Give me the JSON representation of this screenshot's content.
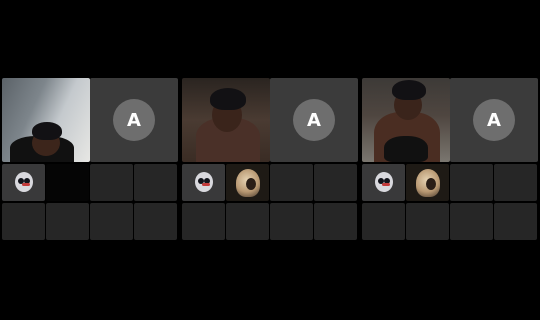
{
  "panels": [
    {
      "avatar_letter": "A",
      "participant_icons": [
        "ghost-avatar"
      ]
    },
    {
      "avatar_letter": "A",
      "participant_icons": [
        "ghost-avatar",
        "blonde-avatar"
      ]
    },
    {
      "avatar_letter": "A",
      "participant_icons": [
        "ghost-avatar",
        "blonde-avatar"
      ]
    }
  ]
}
